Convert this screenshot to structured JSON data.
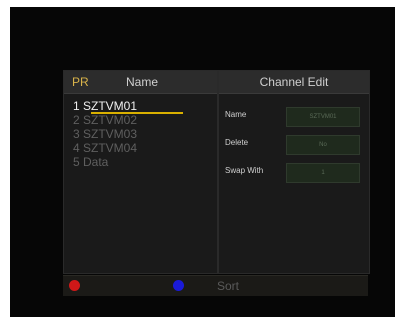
{
  "header": {
    "pr_label": "PR",
    "name_label": "Name",
    "channel_edit_label": "Channel Edit"
  },
  "channels": [
    {
      "label": "1 SZTVM01",
      "selected": true
    },
    {
      "label": "2 SZTVM02",
      "selected": false
    },
    {
      "label": "3 SZTVM03",
      "selected": false
    },
    {
      "label": "4 SZTVM04",
      "selected": false
    },
    {
      "label": "5 Data",
      "selected": false
    }
  ],
  "edit": {
    "name_label": "Name",
    "name_value": "SZTVM01",
    "delete_label": "Delete",
    "delete_value": "No",
    "swap_label": "Swap With",
    "swap_value": "1"
  },
  "footer": {
    "sort_label": "Sort",
    "red_color": "#d01818",
    "blue_color": "#1a1ad8"
  },
  "colors": {
    "accent": "#d9b000",
    "background": "#060606"
  }
}
